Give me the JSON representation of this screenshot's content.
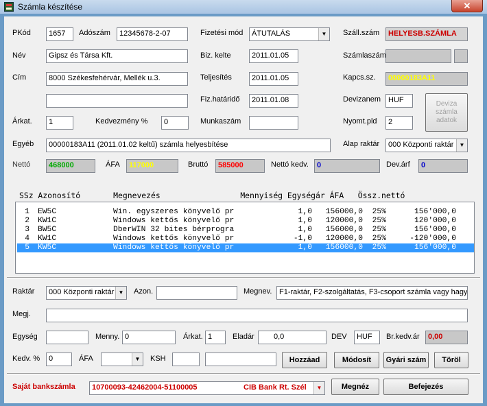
{
  "window": {
    "title": "Számla készítése",
    "close_glyph": "✕"
  },
  "header": {
    "pkod_label": "PKód",
    "pkod_value": "1657",
    "adoszam_label": "Adószám",
    "adoszam_value": "12345678-2-07",
    "fizmod_label": "Fizetési mód",
    "fizmod_value": "ÁTUTALÁS",
    "szallszam_label": "Száll.szám",
    "szallszam_value": "HELYESB.SZÁMLA",
    "nev_label": "Név",
    "nev_value": "Gipsz és Társa Kft.",
    "bizkelte_label": "Biz. kelte",
    "bizkelte_value": "2011.01.05",
    "szamlaszam_label": "Számlaszám",
    "szamlaszam_value": "",
    "cim_label": "Cím",
    "cim_value": "8000 Székesfehérvár, Mellék u.3.",
    "teljesites_label": "Teljesítés",
    "teljesites_value": "2011.01.05",
    "kapcssz_label": "Kapcs.sz.",
    "kapcssz_value": "00000183A11",
    "cim2_value": "",
    "fizhatarido_label": "Fiz.határidő",
    "fizhatarido_value": "2011.01.08",
    "devizanem_label": "Devizanem",
    "devizanem_value": "HUF",
    "deviza_btn": [
      "Deviza",
      "számla",
      "adatok"
    ],
    "arkat_label": "Árkat.",
    "arkat_value": "1",
    "kedvezmeny_label": "Kedvezmény %",
    "kedvezmeny_value": "0",
    "munkaszam_label": "Munkaszám",
    "munkaszam_value": "",
    "nyomtpld_label": "Nyomt.pld",
    "nyomtpld_value": "2",
    "egyeb_label": "Egyéb",
    "egyeb_value": "00000183A11 (2011.01.02 keltű) számla helyesbítése",
    "alapraktar_label": "Alap raktár",
    "alapraktar_value": "000 Központi raktár",
    "netto_label": "Nettó",
    "netto_value": "468000",
    "afa_label": "ÁFA",
    "afa_value": "117000",
    "brutto_label": "Bruttó",
    "brutto_value": "585000",
    "nettokedv_label": "Nettó kedv.",
    "nettokedv_value": "0",
    "devarf_label": "Dev.árf",
    "devarf_value": "0"
  },
  "table": {
    "header": "SSz Azonosító       Megnevezés                 Mennyiség Egységár ÁFA   Össz.nettó",
    "rows": [
      {
        "ssz": "1",
        "azon": "EW5C",
        "megnev": "Win. egyszeres könyvelő pr",
        "menny": "1,0",
        "egysegar": "156000,0",
        "afa": "25%",
        "ossz": "156'000,0"
      },
      {
        "ssz": "2",
        "azon": "KW1C",
        "megnev": "Windows kettős könyvelő pr",
        "menny": "1,0",
        "egysegar": "120000,0",
        "afa": "25%",
        "ossz": "120'000,0"
      },
      {
        "ssz": "3",
        "azon": "BW5C",
        "megnev": "DberWIN 32 bites bérprogra",
        "menny": "1,0",
        "egysegar": "156000,0",
        "afa": "25%",
        "ossz": "156'000,0"
      },
      {
        "ssz": "4",
        "azon": "KW1C",
        "megnev": "Windows kettős könyvelő pr",
        "menny": "-1,0",
        "egysegar": "120000,0",
        "afa": "25%",
        "ossz": "-120'000,0"
      },
      {
        "ssz": "5",
        "azon": "KW5C",
        "megnev": "Windows kettős könyvelő pr",
        "menny": "1,0",
        "egysegar": "156000,0",
        "afa": "25%",
        "ossz": "156'000,0"
      }
    ],
    "selected_row": 4
  },
  "item": {
    "raktar_label": "Raktár",
    "raktar_value": "000 Központi raktár",
    "azon_label": "Azon.",
    "azon_value": "",
    "megnev_label": "Megnev.",
    "megnev_value": "F1-raktár, F2-szolgáltatás, F3-csoport számla vagy hagyja ü",
    "megj_label": "Megj.",
    "megj_value": "",
    "egyseg_label": "Egység",
    "egyseg_value": "",
    "menny_label": "Menny.",
    "menny_value": "0",
    "arkat_label": "Árkat.",
    "arkat_value": "1",
    "eladar_label": "Eladár",
    "eladar_value": "0,0",
    "dev_label": "DEV",
    "dev_value": "HUF",
    "brkedvar_label": "Br.kedv.ár",
    "brkedvar_value": "0,00",
    "kedv_label": "Kedv. %",
    "kedv_value": "0",
    "afa_label": "ÁFA",
    "afa_value": "",
    "ksh_label": "KSH",
    "ksh_value": "",
    "ksh2_value": ""
  },
  "buttons": {
    "hozzaad": "Hozzáad",
    "modosit": "Módosít",
    "gyari": "Gyári szám",
    "torol": "Töröl",
    "megnez": "Megnéz",
    "befejezes": "Befejezés"
  },
  "bank": {
    "label": "Saját bankszámla",
    "account": "10700093-42462004-51100005",
    "bank": "CIB Bank Rt. Szél"
  },
  "colors": {
    "red": "#cc0000",
    "netto": "#00aa00",
    "afa": "#ffff00",
    "brutto": "#ff0000",
    "blue": "#0000cc",
    "selection": "#3399ff"
  }
}
